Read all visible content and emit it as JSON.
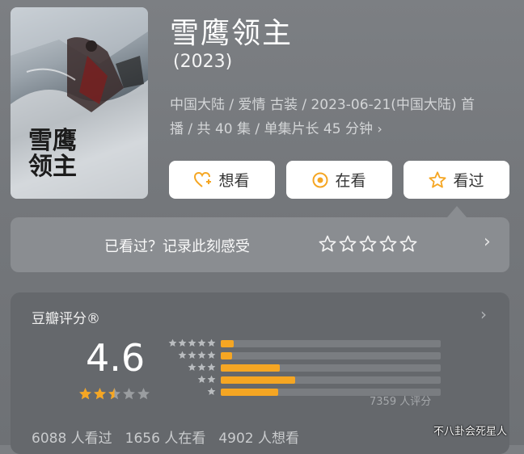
{
  "title": "雪鹰领主",
  "year": "(2023)",
  "poster": {
    "title_text": "雪鹰领主"
  },
  "meta": {
    "line1": "中国大陆 / 爱情 古装 / 2023-06-21(中国大陆) 首",
    "line2": "播 / 共 40 集 / 单集片长 45 分钟",
    "chevron": "›"
  },
  "buttons": [
    {
      "label": "想看",
      "icon": "heart-plus-icon"
    },
    {
      "label": "在看",
      "icon": "target-icon"
    },
    {
      "label": "看过",
      "icon": "star-outline-icon"
    }
  ],
  "recorder": {
    "text": "已看过？记录此刻感受",
    "stars": 5,
    "chevron": "›"
  },
  "rating": {
    "title": "豆瓣评分®",
    "chevron": "›",
    "score": "4.6",
    "stars_filled": 2.5,
    "stars_total": 5,
    "distribution": [
      {
        "stars": 5,
        "fraction": 0.06
      },
      {
        "stars": 4,
        "fraction": 0.05
      },
      {
        "stars": 3,
        "fraction": 0.27
      },
      {
        "stars": 2,
        "fraction": 0.34
      },
      {
        "stars": 1,
        "fraction": 0.26
      }
    ],
    "count_text": "7359 人评分",
    "stats": [
      "6088 人看过",
      "1656 人在看",
      "4902 人想看"
    ]
  },
  "watermark": "不八卦会死星人",
  "colors": {
    "accent": "#f5a623",
    "button_icon": "#f5a623"
  }
}
